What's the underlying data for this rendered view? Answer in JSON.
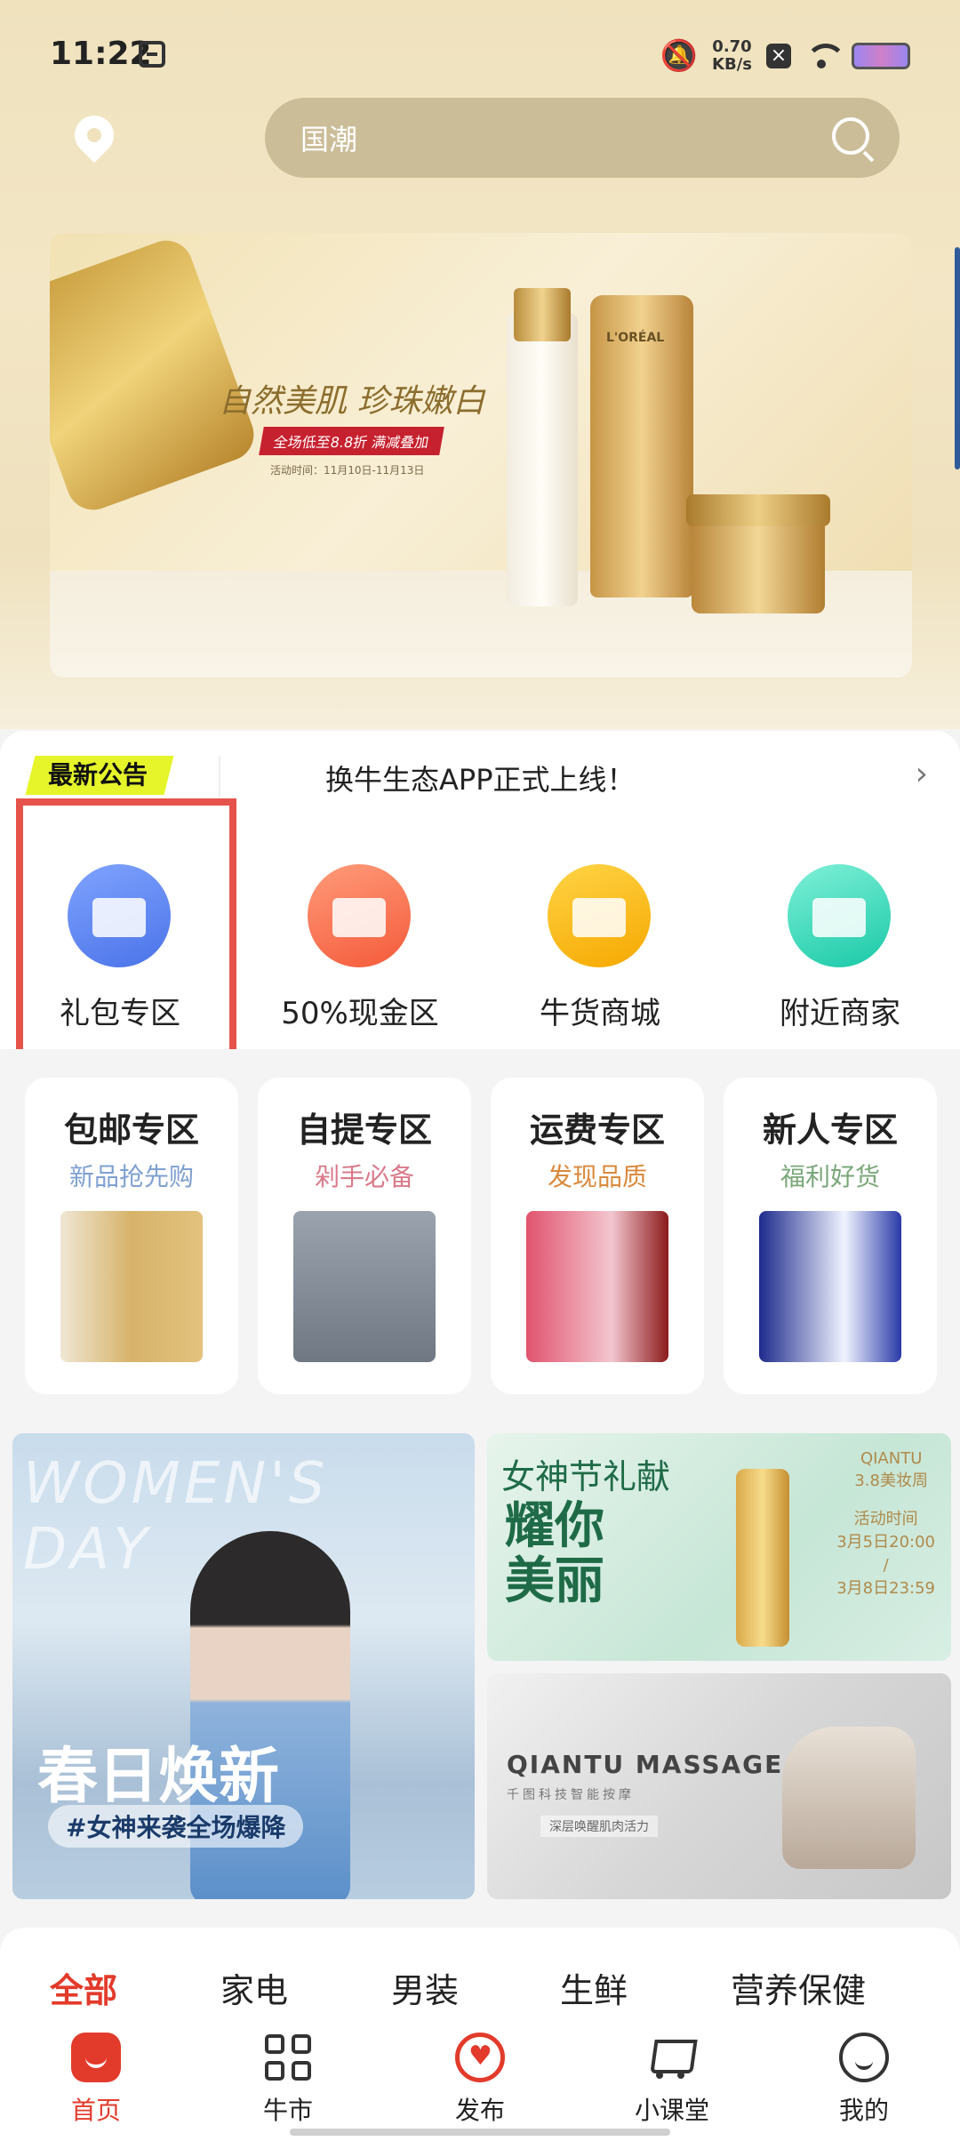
{
  "status_bar": {
    "time": "11:22",
    "speed_value": "0.70",
    "speed_unit": "KB/s"
  },
  "search": {
    "placeholder": "国潮"
  },
  "banner": {
    "headline": "自然美肌 珍珠嫩白",
    "tag": "全场低至8.8折 满减叠加",
    "date": "活动时间：11月10日-11月13日",
    "brand_text": "L'ORÉAL"
  },
  "notice": {
    "badge": "最新公告",
    "text": "换牛生态APP正式上线！",
    "arrow": "›"
  },
  "categories": [
    {
      "label": "礼包专区"
    },
    {
      "label": "50%现金区"
    },
    {
      "label": "牛货商城"
    },
    {
      "label": "附近商家"
    }
  ],
  "zones": [
    {
      "title": "包邮专区",
      "subtitle": "新品抢先购"
    },
    {
      "title": "自提专区",
      "subtitle": "剁手必备"
    },
    {
      "title": "运费专区",
      "subtitle": "发现品质"
    },
    {
      "title": "新人专区",
      "subtitle": "福利好货"
    }
  ],
  "promos": {
    "left": {
      "watermark": "WOMEN'S DAY",
      "headline": "春日焕新",
      "tag": "#女神来袭全场爆降"
    },
    "top_right": {
      "line1": "女神节礼献",
      "line2": "耀你美丽",
      "brand": "QIANTU",
      "event": "3.8美妆周",
      "date_label": "活动时间",
      "date_start": "3月5日20:00",
      "date_sep": "/",
      "date_end": "3月8日23:59"
    },
    "bottom_right": {
      "title": "QIANTU MASSAGE",
      "subtitle": "千图科技智能按摩",
      "tagline": "深层唤醒肌肉活力"
    }
  },
  "tabs": [
    {
      "label": "全部",
      "active": true
    },
    {
      "label": "家电",
      "active": false
    },
    {
      "label": "男装",
      "active": false
    },
    {
      "label": "生鲜",
      "active": false
    },
    {
      "label": "营养保健",
      "active": false
    }
  ],
  "nav": [
    {
      "label": "首页",
      "icon": "home-icon",
      "active": true
    },
    {
      "label": "牛市",
      "icon": "grid-icon",
      "active": false
    },
    {
      "label": "发布",
      "icon": "publish-icon",
      "active": false
    },
    {
      "label": "小课堂",
      "icon": "cart-icon",
      "active": false
    },
    {
      "label": "我的",
      "icon": "profile-icon",
      "active": false
    }
  ],
  "colors": {
    "accent": "#e23b2b",
    "highlight": "#e5534b",
    "notice_badge": "#e6f52a"
  }
}
